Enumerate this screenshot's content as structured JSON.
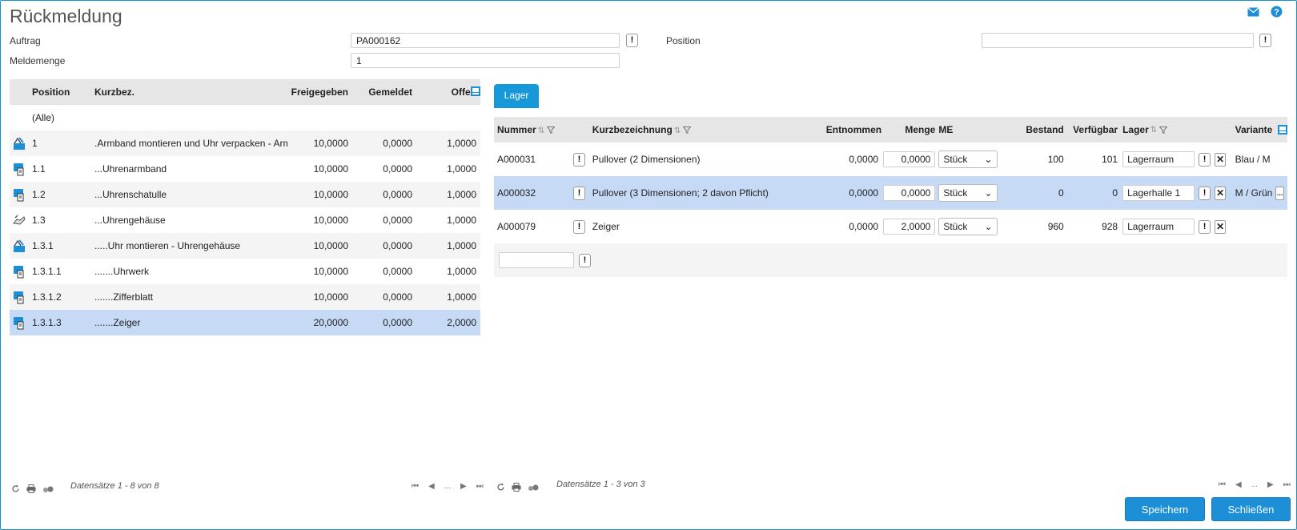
{
  "page": {
    "title": "Rückmeldung"
  },
  "form": {
    "auftrag_label": "Auftrag",
    "auftrag_value": "PA000162",
    "position_label": "Position",
    "position_value": "",
    "meldemenge_label": "Meldemenge",
    "meldemenge_value": "1",
    "warn_symbol": "!"
  },
  "left_grid": {
    "columns": [
      "Position",
      "Kurzbez.",
      "Freigegeben",
      "Gemeldet",
      "Offen"
    ],
    "all_label": "(Alle)",
    "rows": [
      {
        "icon": "assembly-icon",
        "position": "1",
        "kurzbez": ".Armband montieren und Uhr verpacken - Arm",
        "freigegeben": "10,0000",
        "gemeldet": "0,0000",
        "offen": "1,0000"
      },
      {
        "icon": "part-icon",
        "position": "1.1",
        "kurzbez": "...Uhrenarmband",
        "freigegeben": "10,0000",
        "gemeldet": "0,0000",
        "offen": "1,0000"
      },
      {
        "icon": "part-icon",
        "position": "1.2",
        "kurzbez": "...Uhrenschatulle",
        "freigegeben": "10,0000",
        "gemeldet": "0,0000",
        "offen": "1,0000"
      },
      {
        "icon": "hand-icon",
        "position": "1.3",
        "kurzbez": "...Uhrengehäuse",
        "freigegeben": "10,0000",
        "gemeldet": "0,0000",
        "offen": "1,0000"
      },
      {
        "icon": "assembly-icon",
        "position": "1.3.1",
        "kurzbez": ".....Uhr montieren - Uhrengehäuse",
        "freigegeben": "10,0000",
        "gemeldet": "0,0000",
        "offen": "1,0000"
      },
      {
        "icon": "part-icon",
        "position": "1.3.1.1",
        "kurzbez": ".......Uhrwerk",
        "freigegeben": "10,0000",
        "gemeldet": "0,0000",
        "offen": "1,0000"
      },
      {
        "icon": "part-icon",
        "position": "1.3.1.2",
        "kurzbez": ".......Zifferblatt",
        "freigegeben": "10,0000",
        "gemeldet": "0,0000",
        "offen": "1,0000"
      },
      {
        "icon": "part-icon",
        "position": "1.3.1.3",
        "kurzbez": ".......Zeiger",
        "freigegeben": "20,0000",
        "gemeldet": "0,0000",
        "offen": "2,0000"
      }
    ],
    "footer": "Datensätze 1 - 8 von 8"
  },
  "tabs": {
    "lager": "Lager"
  },
  "right_grid": {
    "columns": [
      "Nummer",
      "Kurzbezeichnung",
      "Entnommen",
      "Menge",
      "ME",
      "Bestand",
      "Verfügbar",
      "Lager",
      "Variante"
    ],
    "rows": [
      {
        "nummer": "A000031",
        "kurzbez": "Pullover (2 Dimensionen)",
        "entnommen": "0,0000",
        "menge": "0,0000",
        "me": "Stück",
        "bestand": "100",
        "verfuegbar": "101",
        "lager": "Lagerraum",
        "variante": "Blau / M"
      },
      {
        "nummer": "A000032",
        "kurzbez": "Pullover (3 Dimensionen; 2 davon Pflicht)",
        "entnommen": "0,0000",
        "menge": "0,0000",
        "me": "Stück",
        "bestand": "0",
        "verfuegbar": "0",
        "lager": "Lagerhalle 1",
        "variante": "M / Grün",
        "more": "..."
      },
      {
        "nummer": "A000079",
        "kurzbez": "Zeiger",
        "entnommen": "0,0000",
        "menge": "2,0000",
        "me": "Stück",
        "bestand": "960",
        "verfuegbar": "928",
        "lager": "Lagerraum",
        "variante": ""
      }
    ],
    "new_row_value": "",
    "footer": "Datensätze 1 - 3 von 3"
  },
  "pager": {
    "ellipsis": "..."
  },
  "buttons": {
    "save": "Speichern",
    "close": "Schließen"
  },
  "colors": {
    "accent": "#1c8fd6",
    "selected_row": "#c6d9f5",
    "header_bg": "#e6e6e6"
  }
}
